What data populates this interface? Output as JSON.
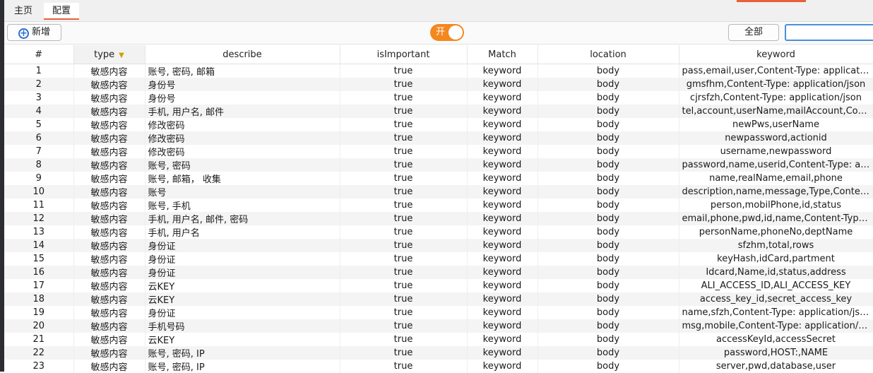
{
  "tabs": [
    {
      "label": "主页"
    },
    {
      "label": "配置"
    }
  ],
  "toolbar": {
    "add_label": "新增",
    "toggle_label": "开",
    "filter_label": "全部",
    "search_value": ""
  },
  "colors": {
    "accent": "#e8603c",
    "toggle_on": "#f5871f",
    "add_icon": "#2f6fce"
  },
  "table": {
    "headers": [
      "#",
      "type",
      "describe",
      "isImportant",
      "Match",
      "location",
      "keyword"
    ],
    "rows": [
      [
        "1",
        "敏感内容",
        "账号, 密码, 邮箱",
        "true",
        "keyword",
        "body",
        "pass,email,user,Content-Type: application/json"
      ],
      [
        "2",
        "敏感内容",
        "身份号",
        "true",
        "keyword",
        "body",
        "gmsfhm,Content-Type: application/json"
      ],
      [
        "3",
        "敏感内容",
        "身份号",
        "true",
        "keyword",
        "body",
        "cjrsfzh,Content-Type: application/json"
      ],
      [
        "4",
        "敏感内容",
        "手机, 用户名, 邮件",
        "true",
        "keyword",
        "body",
        "tel,account,userName,mailAccount,Content-Type: application/json"
      ],
      [
        "5",
        "敏感内容",
        "修改密码",
        "true",
        "keyword",
        "body",
        "newPws,userName"
      ],
      [
        "6",
        "敏感内容",
        "修改密码",
        "true",
        "keyword",
        "body",
        "newpassword,actionid"
      ],
      [
        "7",
        "敏感内容",
        "修改密码",
        "true",
        "keyword",
        "body",
        "username,newpassword"
      ],
      [
        "8",
        "敏感内容",
        "账号, 密码",
        "true",
        "keyword",
        "body",
        "password,name,userid,Content-Type: application/json"
      ],
      [
        "9",
        "敏感内容",
        "账号, 邮箱， 收集",
        "true",
        "keyword",
        "body",
        "name,realName,email,phone"
      ],
      [
        "10",
        "敏感内容",
        "账号",
        "true",
        "keyword",
        "body",
        "description,name,message,Type,Content-Type: application/json"
      ],
      [
        "11",
        "敏感内容",
        "账号, 手机",
        "true",
        "keyword",
        "body",
        "person,mobilPhone,id,status"
      ],
      [
        "12",
        "敏感内容",
        "手机, 用户名, 邮件, 密码",
        "true",
        "keyword",
        "body",
        "email,phone,pwd,id,name,Content-Type: application/json"
      ],
      [
        "13",
        "敏感内容",
        "手机, 用户名",
        "true",
        "keyword",
        "body",
        "personName,phoneNo,deptName"
      ],
      [
        "14",
        "敏感内容",
        "身份证",
        "true",
        "keyword",
        "body",
        "sfzhm,total,rows"
      ],
      [
        "15",
        "敏感内容",
        "身份证",
        "true",
        "keyword",
        "body",
        "keyHash,idCard,partment"
      ],
      [
        "16",
        "敏感内容",
        "身份证",
        "true",
        "keyword",
        "body",
        "Idcard,Name,id,status,address"
      ],
      [
        "17",
        "敏感内容",
        "云KEY",
        "true",
        "keyword",
        "body",
        "ALI_ACCESS_ID,ALI_ACCESS_KEY"
      ],
      [
        "18",
        "敏感内容",
        "云KEY",
        "true",
        "keyword",
        "body",
        "access_key_id,secret_access_key"
      ],
      [
        "19",
        "敏感内容",
        "身份证",
        "true",
        "keyword",
        "body",
        "name,sfzh,Content-Type: application/json"
      ],
      [
        "20",
        "敏感内容",
        "手机号码",
        "true",
        "keyword",
        "body",
        "msg,mobile,Content-Type: application/json"
      ],
      [
        "21",
        "敏感内容",
        "云KEY",
        "true",
        "keyword",
        "body",
        "accessKeyId,accessSecret"
      ],
      [
        "22",
        "敏感内容",
        "账号, 密码, IP",
        "true",
        "keyword",
        "body",
        "password,HOST:,NAME"
      ],
      [
        "23",
        "敏感内容",
        "账号, 密码, IP",
        "true",
        "keyword",
        "body",
        "server,pwd,database,user"
      ]
    ]
  }
}
